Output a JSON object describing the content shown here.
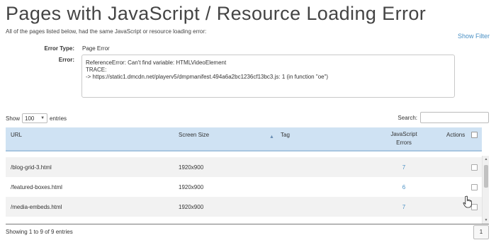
{
  "header": {
    "title": "Pages with JavaScript / Resource Loading Error",
    "subtitle": "All of the pages listed below, had the same JavaScript or resource loading error:",
    "show_filter": "Show Filter"
  },
  "error": {
    "type_label": "Error Type:",
    "type_value": "Page Error",
    "error_label": "Error:",
    "lines": [
      "ReferenceError: Can't find variable: HTMLVideoElement",
      "TRACE:",
      "-> https://static1.dmcdn.net/playerv5/dmpmanifest.494a6a2bc1236cf13bc3.js: 1 (in function \"oe\")"
    ]
  },
  "controls": {
    "show_label": "Show",
    "entries_value": "100",
    "entries_label": "entries",
    "search_label": "Search:",
    "search_value": ""
  },
  "table": {
    "columns": {
      "url": "URL",
      "screen_size": "Screen Size",
      "tag": "Tag",
      "js_errors_line1": "JavaScript",
      "js_errors_line2": "Errors",
      "actions": "Actions"
    },
    "rows": [
      {
        "url": "/blog-grid-3.html",
        "screen_size": "1920x900",
        "tag": "",
        "js_errors": "7"
      },
      {
        "url": "/featured-boxes.html",
        "screen_size": "1920x900",
        "tag": "",
        "js_errors": "6"
      },
      {
        "url": "/media-embeds.html",
        "screen_size": "1920x900",
        "tag": "",
        "js_errors": "7"
      }
    ]
  },
  "footer": {
    "info": "Showing 1 to 9 of 9 entries",
    "page": "1"
  },
  "colors": {
    "header_bg": "#cfe2f3",
    "link": "#4a90c4"
  }
}
